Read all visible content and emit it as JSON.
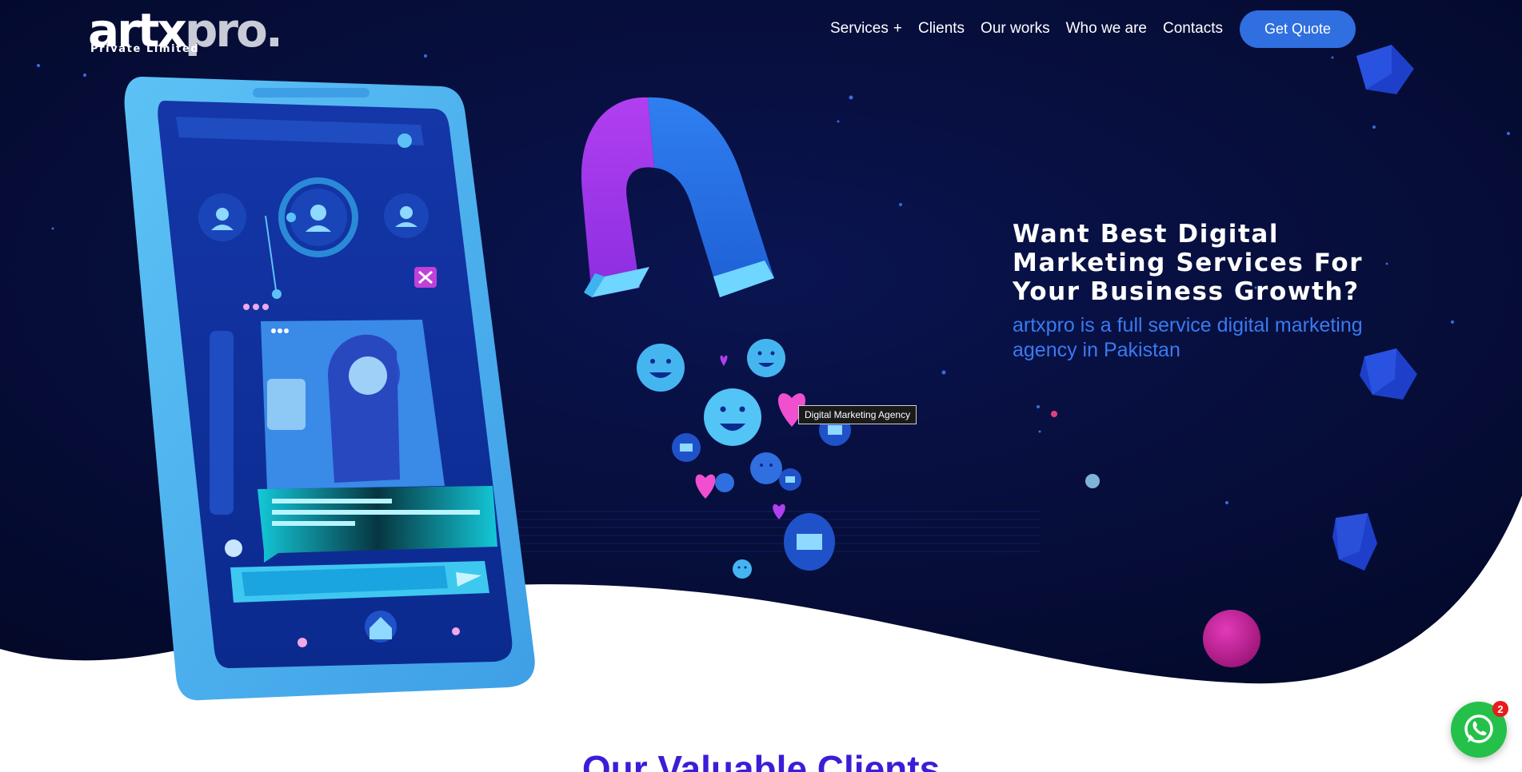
{
  "brand": {
    "logo_main": "artx",
    "logo_accent": "pro.",
    "logo_sub": "Private Limited"
  },
  "nav": {
    "items": [
      {
        "label": "Services",
        "suffix": "+"
      },
      {
        "label": "Clients"
      },
      {
        "label": "Our works"
      },
      {
        "label": "Who we are"
      },
      {
        "label": "Contacts"
      }
    ],
    "cta_label": "Get Quote"
  },
  "hero": {
    "title": "Want Best Digital Marketing Services For Your Business Growth?",
    "subtitle": "artxpro is a full service digital marketing agency in Pakistan",
    "tooltip": "Digital Marketing Agency"
  },
  "clients": {
    "heading": "Our Valuable Clients"
  },
  "whatsapp": {
    "badge_count": "2"
  },
  "colors": {
    "hero_bg": "#050b33",
    "accent_blue": "#2f6fe0",
    "subtitle_blue": "#3a7af0",
    "heading_purple": "#3d1cd8",
    "whatsapp_green": "#25c04a"
  }
}
